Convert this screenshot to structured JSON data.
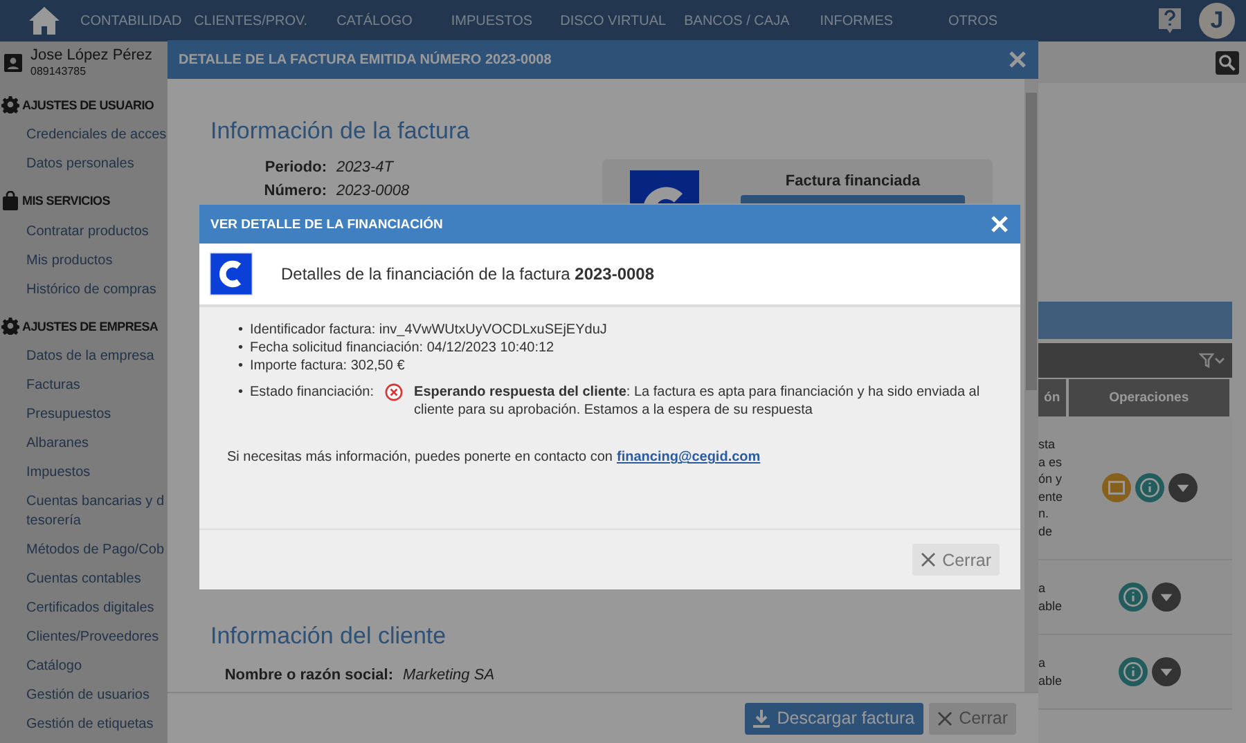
{
  "nav": {
    "items": [
      "CONTABILIDAD",
      "CLIENTES/PROV.",
      "CATÁLOGO",
      "IMPUESTOS",
      "DISCO VIRTUAL",
      "BANCOS / CAJA",
      "INFORMES",
      "OTROS"
    ],
    "avatar_initial": "J"
  },
  "user": {
    "name": "Jose López Pérez",
    "id": "089143785"
  },
  "sidebar": {
    "sections": [
      {
        "title": "AJUSTES DE USUARIO",
        "kind": "gear",
        "items": [
          "Credenciales de acces",
          "Datos personales"
        ]
      },
      {
        "title": "MIS SERVICIOS",
        "kind": "bag",
        "items": [
          "Contratar productos",
          "Mis productos",
          "Histórico de compras"
        ]
      },
      {
        "title": "AJUSTES DE EMPRESA",
        "kind": "gear",
        "items": [
          "Datos de la empresa",
          "Facturas",
          "Presupuestos",
          "Albaranes",
          "Impuestos",
          "Cuentas bancarias y d\ntesorería",
          "Métodos de Pago/Cob",
          "Cuentas contables",
          "Certificados digitales",
          "Clientes/Proveedores",
          "Catálogo",
          "Gestión de usuarios",
          "Gestión de etiquetas"
        ]
      }
    ]
  },
  "background_table": {
    "columns": [
      "ón",
      "Operaciones"
    ],
    "rows": [
      {
        "fragments": [
          "sta",
          "a es",
          "ón y",
          "ente",
          "n.",
          "de"
        ],
        "actions": [
          {
            "kind": "report"
          },
          {
            "kind": "info"
          },
          {
            "kind": "more"
          }
        ]
      },
      {
        "fragments": [
          "a",
          "able"
        ],
        "actions": [
          {
            "kind": "info"
          },
          {
            "kind": "more"
          }
        ]
      },
      {
        "fragments": [
          "a",
          "able"
        ],
        "actions": [
          {
            "kind": "info"
          },
          {
            "kind": "more"
          }
        ]
      }
    ]
  },
  "invoice_dialog": {
    "title": "DETALLE DE LA FACTURA EMITIDA NÚMERO 2023-0008",
    "section_title": "Información de la factura",
    "fields": [
      {
        "label": "Periodo:",
        "value": "2023-4T"
      },
      {
        "label": "Número:",
        "value": "2023-0008"
      }
    ],
    "card": {
      "title": "Factura financiada"
    },
    "client_section_title": "Información del cliente",
    "client_fields": [
      {
        "label": "Nombre o razón social:",
        "value": "Marketing SA"
      }
    ],
    "buttons": [
      {
        "label": "Descargar factura",
        "kind": "primary"
      },
      {
        "label": "Cerrar",
        "kind": "secondary"
      }
    ]
  },
  "financing_dialog": {
    "title": "VER DETALLE DE LA FINANCIACIÓN",
    "heading": "Detalles de la financiación de la factura **2023-0008**",
    "details": [
      {
        "bullet": "•",
        "text": "Identificador factura: inv_4VwWUtxUyVOCDLxuSEjEYduJ"
      },
      {
        "bullet": "•",
        "text": "Fecha solicitud financiación: 04/12/2023 10:40:12"
      },
      {
        "bullet": "•",
        "text": "Importe factura: 302,50 €"
      }
    ],
    "status": {
      "bullet": "•",
      "label": "Estado financiación:",
      "kind": "error",
      "text": "**Esperando respuesta del cliente**: La factura es apta para financiación y ha sido enviada al cliente para su aprobación. Estamos a la espera de su respuesta"
    },
    "contact": {
      "text": "Si necesitas más información, puedes ponerte en contacto con",
      "link": "financing@cegid.com"
    },
    "buttons": [
      {
        "label": "Cerrar",
        "kind": "secondary"
      }
    ]
  }
}
